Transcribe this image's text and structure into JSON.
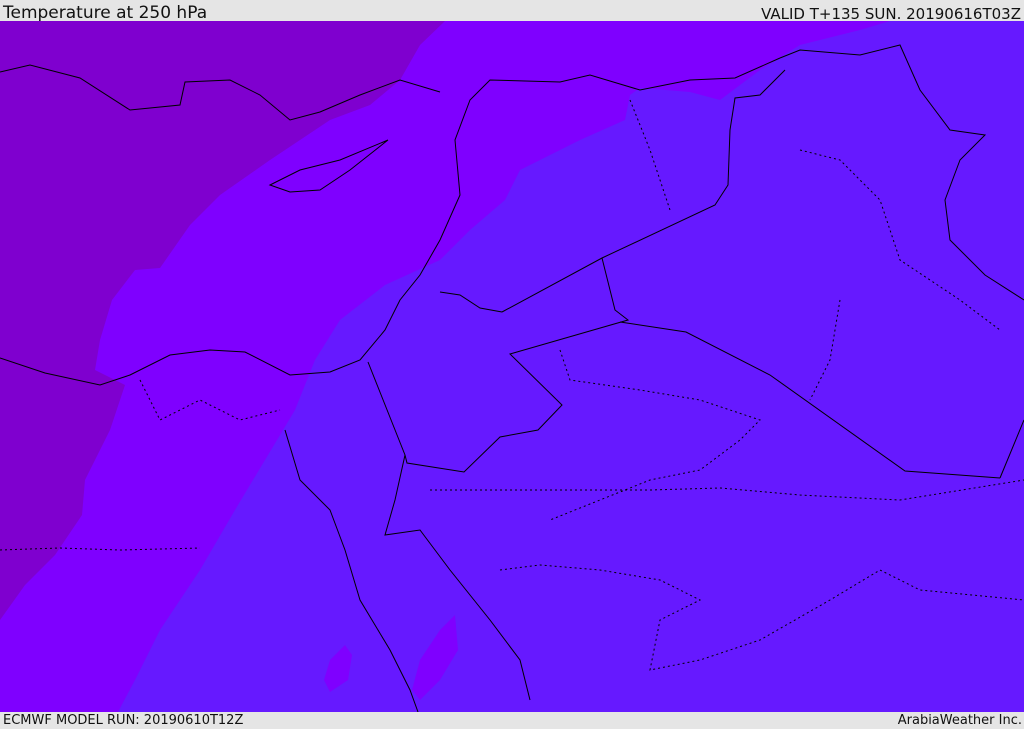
{
  "header": {
    "title": "Temperature at 250 hPa",
    "valid": "VALID T+135 SUN. 20190616T03Z"
  },
  "footer": {
    "model_run": "ECMWF MODEL RUN: 20190610T12Z",
    "credit": "ArabiaWeather Inc."
  },
  "colors": {
    "band_cold": "#7f00cf",
    "band_mid": "#7f00ff",
    "band_warm": "#6619ff",
    "borders": "#000000"
  }
}
